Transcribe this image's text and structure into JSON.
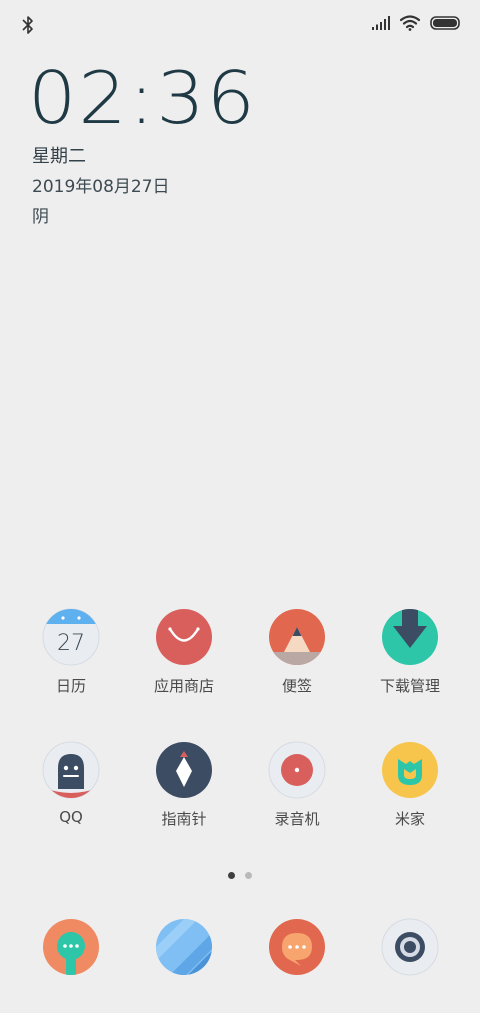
{
  "lockscreen": {
    "time": "02:36",
    "weekday": "星期二",
    "date": "2019年08月27日",
    "weather": "阴"
  },
  "status": {
    "icons": [
      "bluetooth-icon",
      "signal-icon",
      "wifi-icon",
      "battery-icon"
    ],
    "battery_level": 1.0
  },
  "apps_row1": [
    {
      "label": "日历",
      "icon": "calendar-icon",
      "calendar_day": "27"
    },
    {
      "label": "应用商店",
      "icon": "app-store-icon"
    },
    {
      "label": "便签",
      "icon": "notes-icon"
    },
    {
      "label": "下载管理",
      "icon": "download-icon"
    }
  ],
  "apps_row2": [
    {
      "label": "QQ",
      "icon": "qq-icon"
    },
    {
      "label": "指南针",
      "icon": "compass-icon"
    },
    {
      "label": "录音机",
      "icon": "recorder-icon"
    },
    {
      "label": "米家",
      "icon": "mijia-icon"
    }
  ],
  "page_indicator": {
    "pages": 2,
    "current": 1
  },
  "dock": [
    {
      "icon": "phone-app-icon"
    },
    {
      "icon": "browser-icon"
    },
    {
      "icon": "messages-icon"
    },
    {
      "icon": "camera-icon"
    }
  ],
  "colors": {
    "background": "#efeeee",
    "red": "#d95f5d",
    "orange": "#e2674f",
    "teal": "#2ec6a8",
    "navy": "#3c4d63",
    "yellow": "#f7c54b",
    "blue": "#5eb0ee"
  }
}
